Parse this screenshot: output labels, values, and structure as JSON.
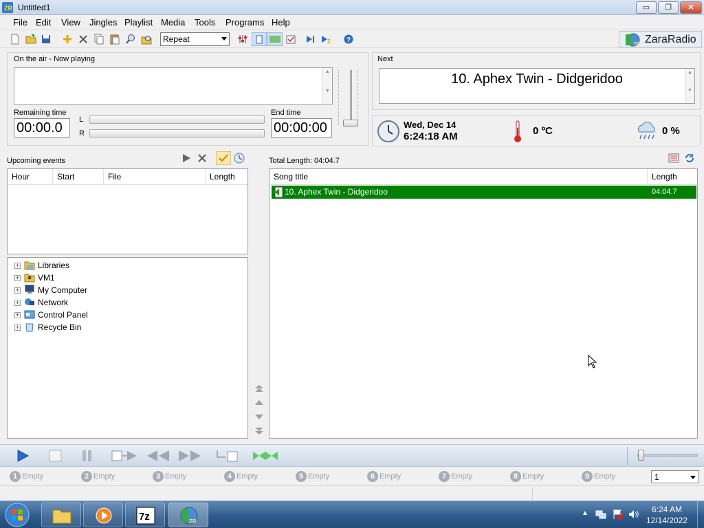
{
  "window": {
    "title": "Untitled1",
    "minimize": "▭",
    "maximize": "❐",
    "close": "✕"
  },
  "menu": [
    "File",
    "Edit",
    "View",
    "Jingles",
    "Playlist",
    "Media",
    "Tools",
    "Programs",
    "Help"
  ],
  "toolbar": {
    "mode_select": "Repeat",
    "brand": "ZaraRadio"
  },
  "now_playing": {
    "label": "On the air - Now playing",
    "remaining_label": "Remaining time",
    "remaining_value": "00:00.0",
    "end_label": "End time",
    "end_value": "00:00:00",
    "channel_left": "L",
    "channel_right": "R"
  },
  "next": {
    "label": "Next",
    "title": "10. Aphex Twin - Didgeridoo"
  },
  "info": {
    "date": "Wed, Dec 14",
    "time": "6:24:18 AM",
    "temperature": "0 ºC",
    "humidity": "0 %"
  },
  "events": {
    "label": "Upcoming events",
    "columns": [
      "Hour",
      "Start",
      "File",
      "Length"
    ]
  },
  "tree": [
    "Libraries",
    "VM1",
    "My Computer",
    "Network",
    "Control Panel",
    "Recycle Bin"
  ],
  "playlist": {
    "total_length": "Total Length: 04:04.7",
    "columns": [
      "Song title",
      "Length"
    ],
    "rows": [
      {
        "title": "10. Aphex Twin - Didgeridoo",
        "length": "04:04.7",
        "selected": true
      }
    ]
  },
  "slots": [
    {
      "n": "1",
      "label": "Empty"
    },
    {
      "n": "2",
      "label": "Empty"
    },
    {
      "n": "3",
      "label": "Empty"
    },
    {
      "n": "4",
      "label": "Empty"
    },
    {
      "n": "5",
      "label": "Empty"
    },
    {
      "n": "6",
      "label": "Empty"
    },
    {
      "n": "7",
      "label": "Empty"
    },
    {
      "n": "8",
      "label": "Empty"
    },
    {
      "n": "9",
      "label": "Empty"
    }
  ],
  "slot_page": "1",
  "taskbar": {
    "time": "6:24 AM",
    "date": "12/14/2022"
  },
  "colors": {
    "selection": "#008000",
    "taskbar": "#2d5a8b"
  }
}
